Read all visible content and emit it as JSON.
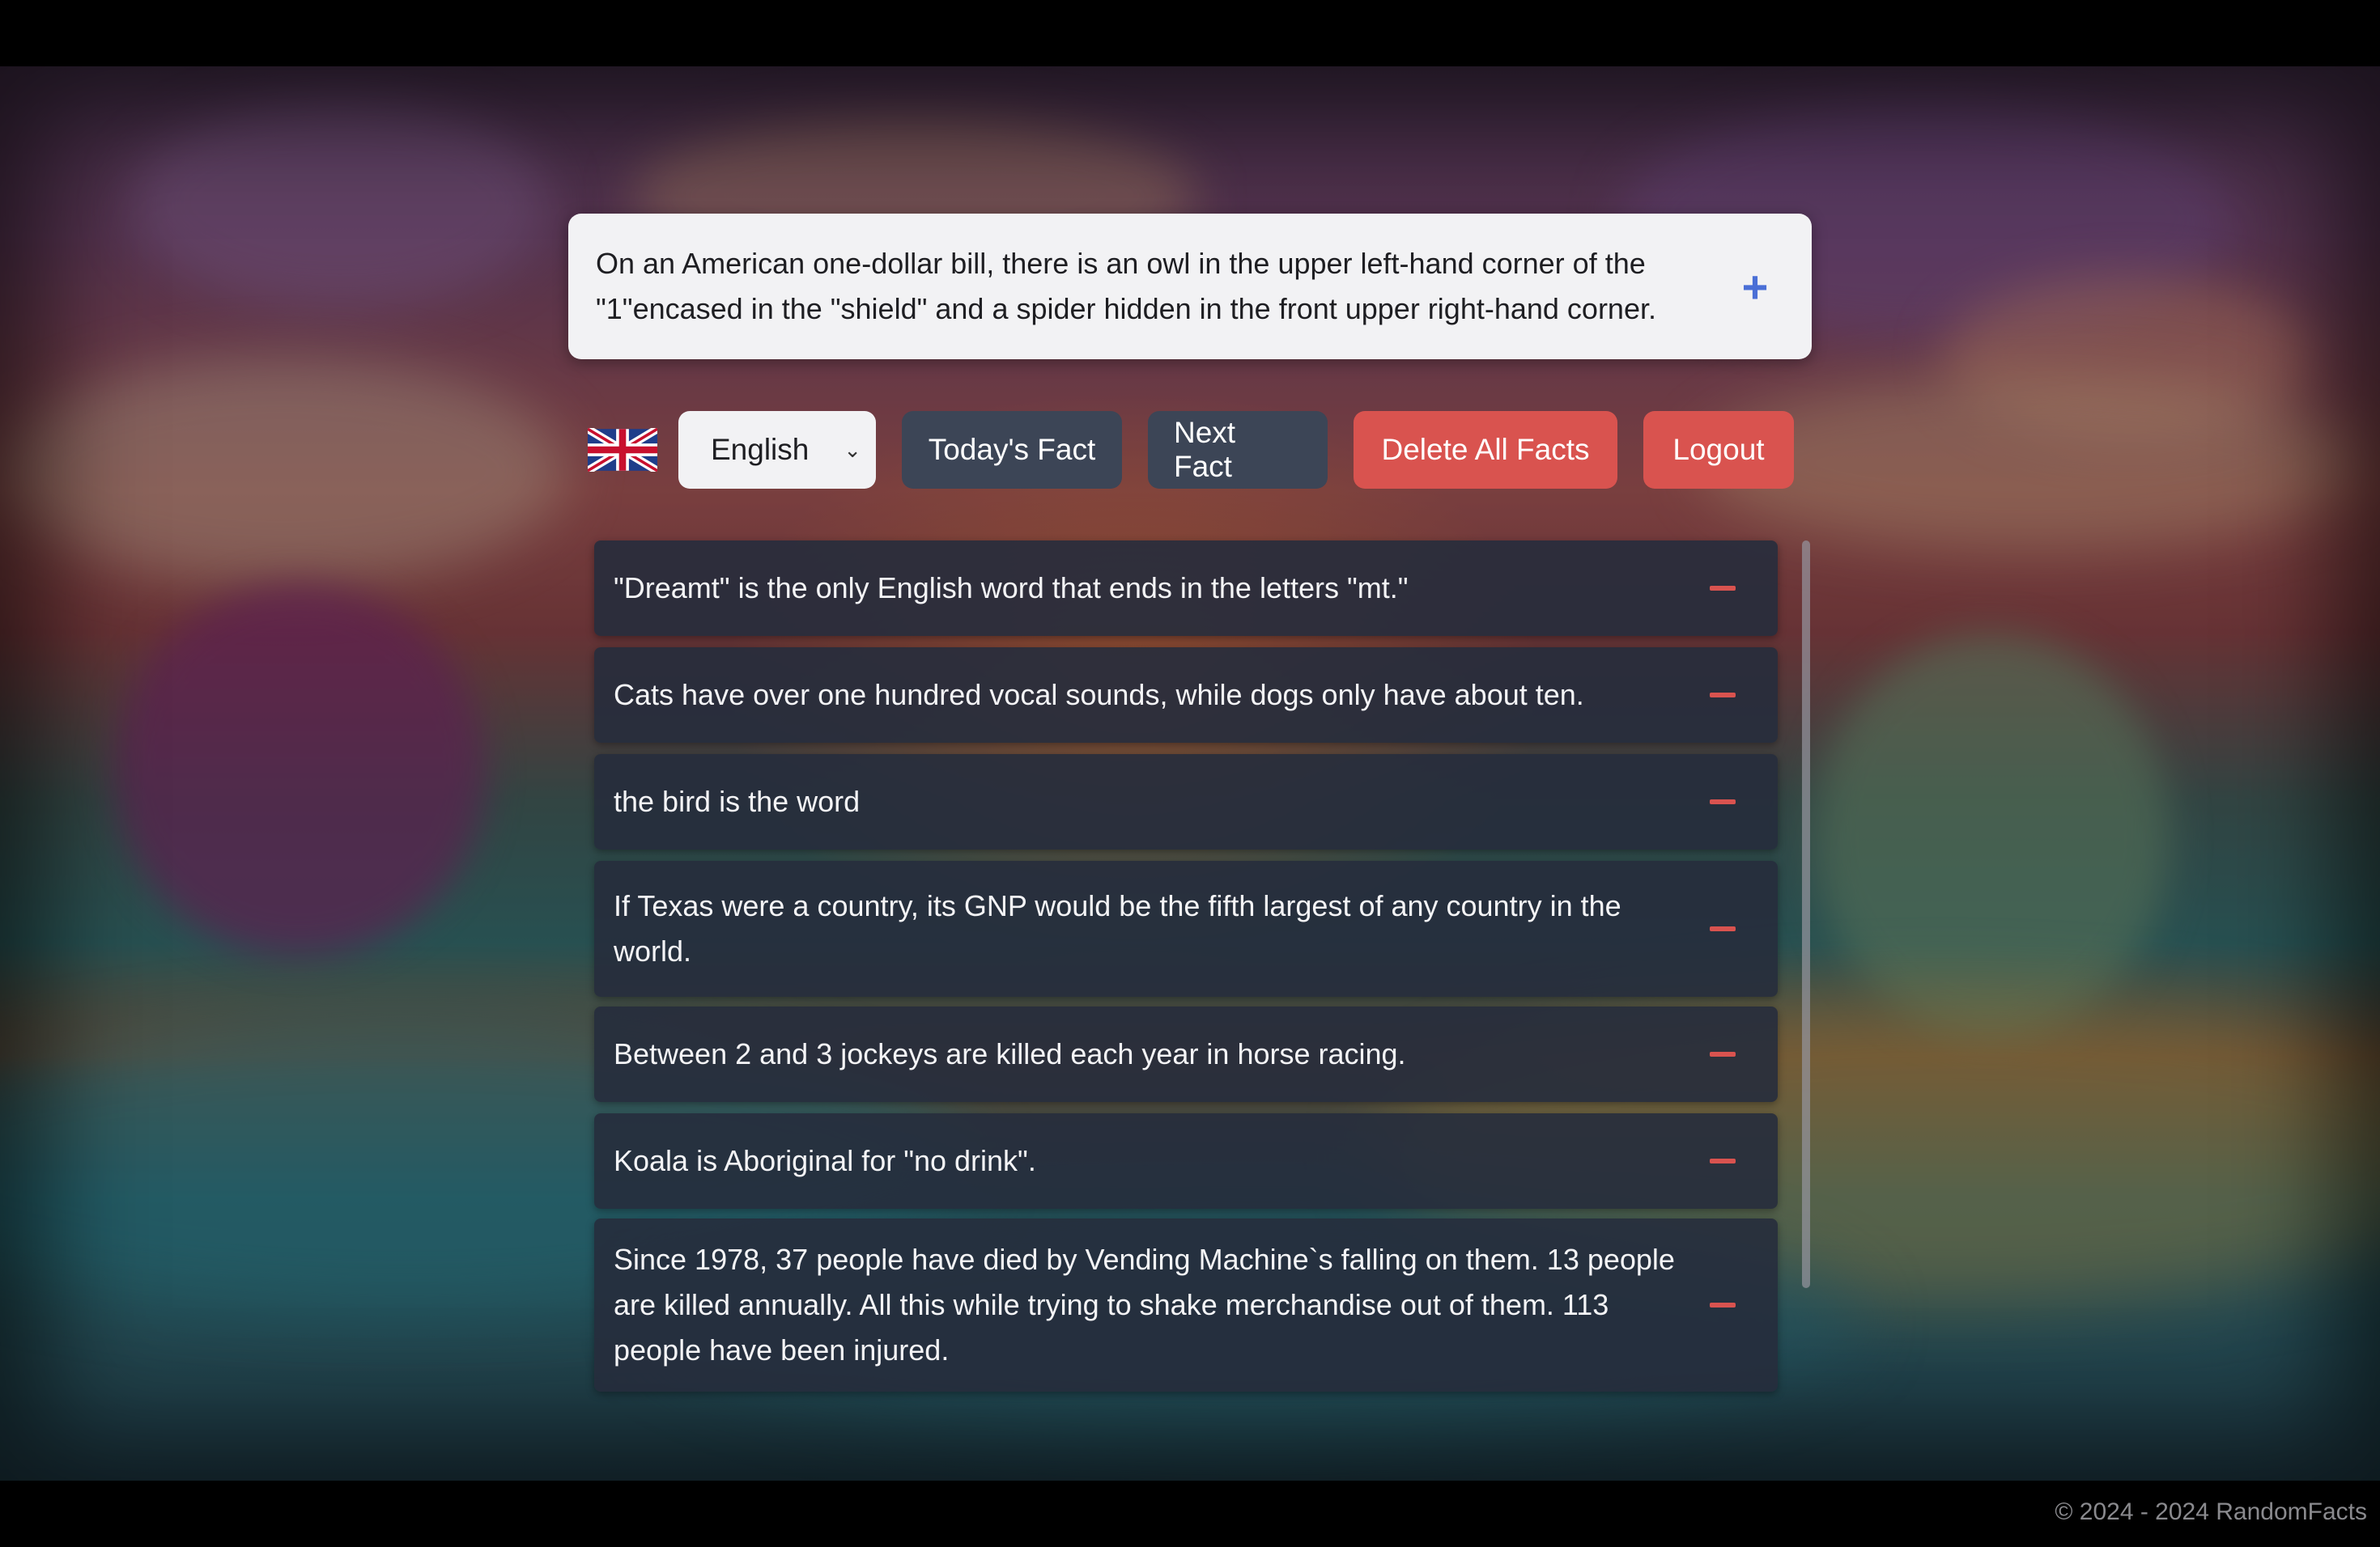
{
  "fact_of_day": {
    "text": "On an American one-dollar bill, there is an owl in the upper left-hand corner of the \"1\"encased in the \"shield\" and a spider hidden in the front upper right-hand corner.",
    "add_icon": "plus-icon",
    "add_glyph": "+"
  },
  "toolbar": {
    "flag": "uk-flag",
    "language": "English",
    "language_chevron": "⌄",
    "todays_fact_label": "Today's Fact",
    "next_fact_label": "Next Fact",
    "delete_all_label": "Delete All Facts",
    "logout_label": "Logout"
  },
  "facts": [
    {
      "text": "\"Dreamt\" is the only English word that ends in the letters \"mt.\""
    },
    {
      "text": "Cats have over one hundred vocal sounds, while dogs only have about ten."
    },
    {
      "text": "the bird is the word"
    },
    {
      "text": "If Texas were a country, its GNP would be the fifth largest of any country in the world."
    },
    {
      "text": "Between 2 and 3 jockeys are killed each year in horse racing."
    },
    {
      "text": "Koala is Aboriginal for \"no drink\"."
    },
    {
      "text": "Since 1978, 37 people have died by Vending Machine`s falling on them.  13 people are killed annually.  All this while trying to shake merchandise out of them. 113 people have been injured."
    }
  ],
  "footer": {
    "text": "© 2024 - 2024 RandomFacts"
  },
  "colors": {
    "accent_blue": "#4a6fd6",
    "danger_red": "#d9534f",
    "button_dark": "#3c4556"
  }
}
